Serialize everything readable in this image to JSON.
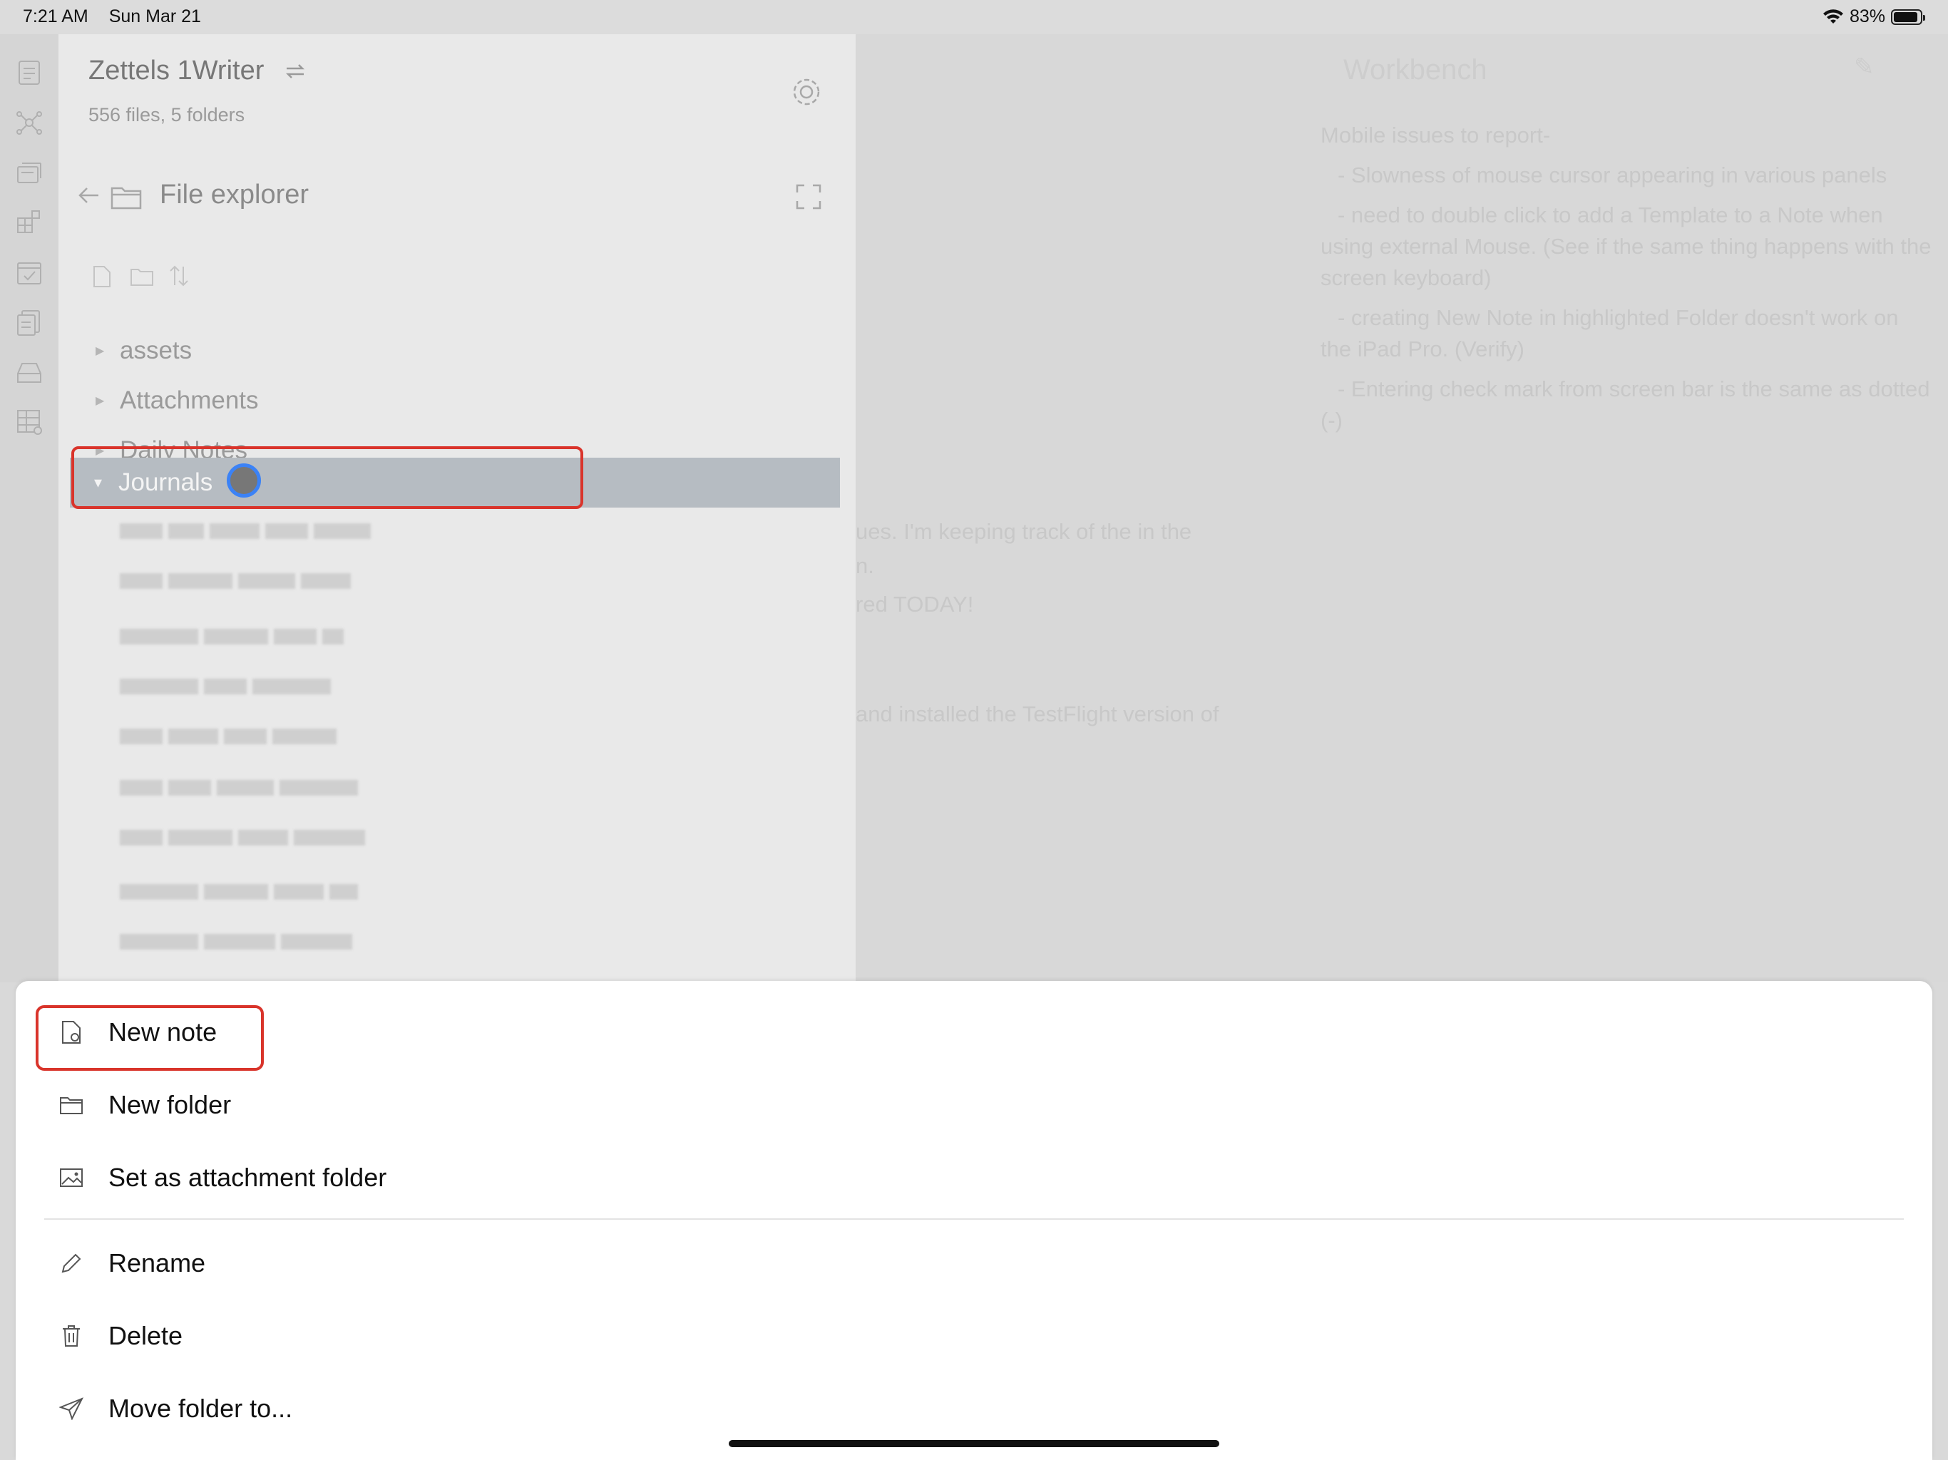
{
  "status_bar": {
    "time": "7:21 AM",
    "date": "Sun Mar 21",
    "battery_percent": "83%",
    "battery_level": 0.83
  },
  "ribbon": {
    "icons": [
      "open-quick-switcher-icon",
      "graph-view-icon",
      "open-today-icon",
      "kanban-icon",
      "calendar-check-icon",
      "templates-icon",
      "archive-icon",
      "database-table-icon"
    ]
  },
  "sidebar": {
    "vault_name": "Zettels 1Writer",
    "vault_stats": "556 files, 5 folders",
    "panel_title": "File explorer",
    "folders": [
      "assets",
      "Attachments",
      "Daily Notes"
    ],
    "selected_folder": "Journals"
  },
  "editor": {
    "title": "Workbench",
    "lines": [
      "Mobile issues to report-",
      "- Slowness of mouse cursor appearing in various panels",
      "- need to double click to add a Template to a Note when using external Mouse. (See if the same thing happens with the screen keyboard)",
      "- creating New Note in highlighted Folder doesn't work on the iPad Pro. (Verify)",
      "- Entering check mark from screen bar is the same as dotted (-)"
    ],
    "fragments": [
      "ues. I'm keeping track of the in the",
      "n.",
      "red TODAY!",
      "and installed the TestFlight version of"
    ]
  },
  "context_menu": {
    "items": [
      {
        "label": "New note",
        "icon": "new-note-icon"
      },
      {
        "label": "New folder",
        "icon": "folder-icon"
      },
      {
        "label": "Set as attachment folder",
        "icon": "image-icon"
      },
      {
        "label": "Rename",
        "icon": "pencil-icon"
      },
      {
        "label": "Delete",
        "icon": "trash-icon"
      },
      {
        "label": "Move folder to...",
        "icon": "send-icon"
      }
    ]
  },
  "colors": {
    "highlight_red": "#d9342b",
    "touch_blue": "#3b82f6",
    "selection_gray": "#b6bcc2"
  }
}
